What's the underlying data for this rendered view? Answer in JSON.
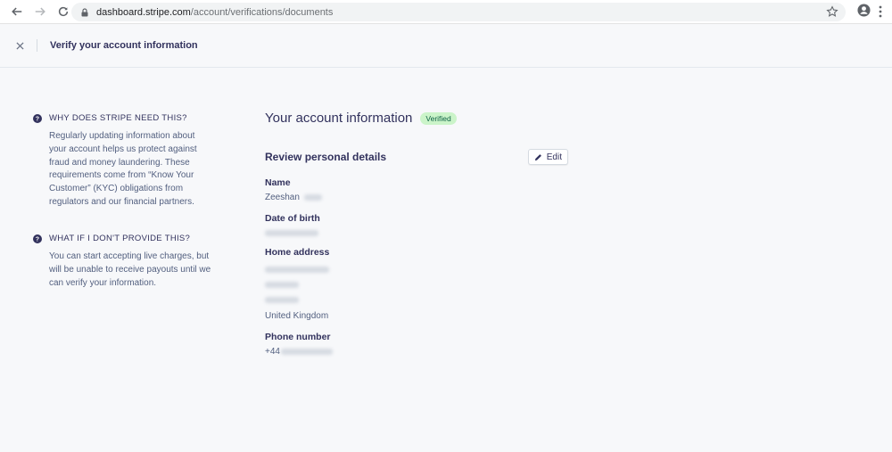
{
  "browser": {
    "url_host": "dashboard.stripe.com",
    "url_path": "/account/verifications/documents",
    "icons": [
      "back-arrow-icon",
      "forward-arrow-icon",
      "reload-icon",
      "lock-icon",
      "star-icon",
      "profile-icon",
      "kebab-menu-icon"
    ]
  },
  "header": {
    "title": "Verify your account information"
  },
  "faq": [
    {
      "question": "WHY DOES STRIPE NEED THIS?",
      "answer": "Regularly updating information about your account helps us protect against fraud and money laundering. These requirements come from “Know Your Customer” (KYC) obligations from regulators and our financial partners."
    },
    {
      "question": "WHAT IF I DON'T PROVIDE THIS?",
      "answer": "You can start accepting live charges, but will be unable to receive payouts until we can verify your information."
    }
  ],
  "main": {
    "title": "Your account information",
    "badge": "Verified",
    "section_title": "Review personal details",
    "edit_label": "Edit",
    "fields": {
      "name_label": "Name",
      "name_value": "Zeeshan",
      "dob_label": "Date of birth",
      "address_label": "Home address",
      "address_country": "United Kingdom",
      "phone_label": "Phone number",
      "phone_prefix": "+44"
    }
  },
  "colors": {
    "badge_bg": "#cbf4c9",
    "badge_text": "#0e6245",
    "page_bg": "#f7f8fa",
    "heading": "#32325d",
    "body_text": "#525f7f"
  }
}
